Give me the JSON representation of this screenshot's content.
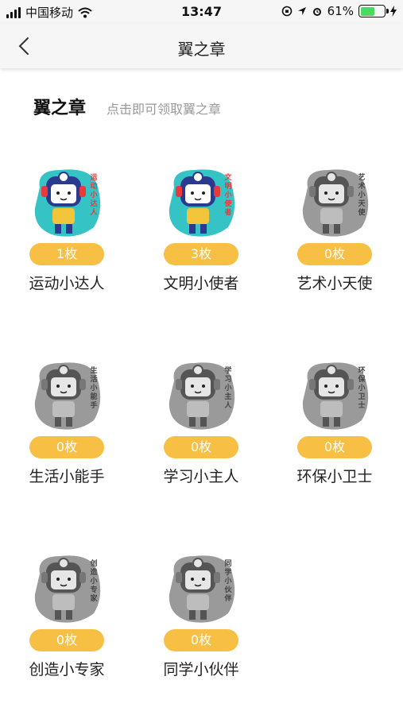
{
  "status_bar": {
    "carrier": "中国移动",
    "time": "13:47",
    "battery": "61%",
    "battery_level": 0.61
  },
  "nav": {
    "title": "翼之章"
  },
  "section": {
    "title": "翼之章",
    "hint": "点击即可领取翼之章"
  },
  "badges": [
    {
      "name": "运动小达人",
      "count": "1枚",
      "caption": "运动小达人",
      "earned": true
    },
    {
      "name": "文明小使者",
      "count": "3枚",
      "caption": "文明小使者",
      "earned": true
    },
    {
      "name": "艺术小天使",
      "count": "0枚",
      "caption": "艺术小天使",
      "earned": false
    },
    {
      "name": "生活小能手",
      "count": "0枚",
      "caption": "生活小能手",
      "earned": false
    },
    {
      "name": "学习小主人",
      "count": "0枚",
      "caption": "学习小主人",
      "earned": false
    },
    {
      "name": "环保小卫士",
      "count": "0枚",
      "caption": "环保小卫士",
      "earned": false
    },
    {
      "name": "创造小专家",
      "count": "0枚",
      "caption": "创造小专家",
      "earned": false
    },
    {
      "name": "同学小伙伴",
      "count": "0枚",
      "caption": "同学小伙伴",
      "earned": false
    }
  ],
  "colors": {
    "count_pill": "#f8bf45",
    "earned_bg": "#36c3c5",
    "unearned_bg": "#9a9a9a"
  },
  "icons": {
    "back": "chevron-left-icon",
    "wifi": "wifi-icon",
    "location": "location-arrow-icon",
    "alarm": "alarm-clock-icon",
    "charging": "charging-bolt-icon",
    "lock": "orientation-lock-icon"
  }
}
